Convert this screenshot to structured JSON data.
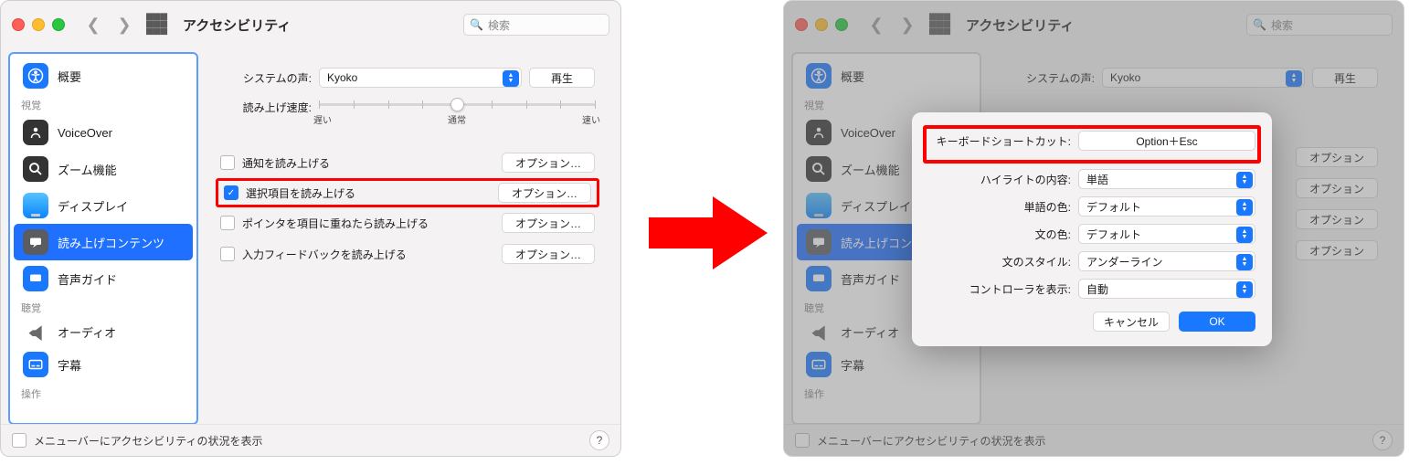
{
  "colors": {
    "accent": "#1a78ff",
    "highlight": "#ff0000"
  },
  "left": {
    "title": "アクセシビリティ",
    "search_placeholder": "検索",
    "sidebar": {
      "items": [
        {
          "label": "概要",
          "icon": "accessibility-icon"
        },
        {
          "label": "VoiceOver",
          "icon": "voiceover-icon"
        },
        {
          "label": "ズーム機能",
          "icon": "zoom-icon"
        },
        {
          "label": "ディスプレイ",
          "icon": "display-icon"
        },
        {
          "label": "読み上げコンテンツ",
          "icon": "speech-icon",
          "selected": true
        },
        {
          "label": "音声ガイド",
          "icon": "descriptions-icon"
        },
        {
          "label": "オーディオ",
          "icon": "audio-icon"
        },
        {
          "label": "字幕",
          "icon": "captions-icon"
        }
      ],
      "section_visual": "視覚",
      "section_hearing": "聴覚",
      "section_motor": "操作"
    },
    "content": {
      "voice_label": "システムの声:",
      "voice_value": "Kyoko",
      "play_button": "再生",
      "speed_label": "読み上げ速度:",
      "speed_slow": "遅い",
      "speed_normal": "通常",
      "speed_fast": "速い",
      "rows": [
        {
          "label": "通知を読み上げる",
          "checked": false,
          "options": "オプション…"
        },
        {
          "label": "選択項目を読み上げる",
          "checked": true,
          "options": "オプション…",
          "highlighted": true
        },
        {
          "label": "ポインタを項目に重ねたら読み上げる",
          "checked": false,
          "options": "オプション…"
        },
        {
          "label": "入力フィードバックを読み上げる",
          "checked": false,
          "options": "オプション…"
        }
      ]
    },
    "footer": {
      "menubar_checkbox_label": "メニューバーにアクセシビリティの状況を表示"
    }
  },
  "right": {
    "title": "アクセシビリティ",
    "search_placeholder": "検索",
    "sidebar": {
      "items": [
        {
          "label": "概要"
        },
        {
          "label": "VoiceOver"
        },
        {
          "label": "ズーム機能"
        },
        {
          "label": "ディスプレイ"
        },
        {
          "label": "読み上げコン",
          "selected": true
        },
        {
          "label": "音声ガイド"
        },
        {
          "label": "オーディオ"
        },
        {
          "label": "字幕"
        }
      ],
      "section_visual": "視覚",
      "section_hearing": "聴覚",
      "section_motor": "操作"
    },
    "content": {
      "voice_label": "システムの声:",
      "voice_value": "Kyoko",
      "play_button": "再生",
      "options_label": "オプション"
    },
    "modal": {
      "shortcut_label": "キーボードショートカット:",
      "shortcut_value": "Option＋Esc",
      "highlight_label": "ハイライトの内容:",
      "highlight_value": "単語",
      "word_color_label": "単語の色:",
      "word_color_value": "デフォルト",
      "sentence_color_label": "文の色:",
      "sentence_color_value": "デフォルト",
      "sentence_style_label": "文のスタイル:",
      "sentence_style_value": "アンダーライン",
      "controller_label": "コントローラを表示:",
      "controller_value": "自動",
      "cancel": "キャンセル",
      "ok": "OK"
    },
    "footer": {
      "menubar_checkbox_label": "メニューバーにアクセシビリティの状況を表示"
    }
  }
}
